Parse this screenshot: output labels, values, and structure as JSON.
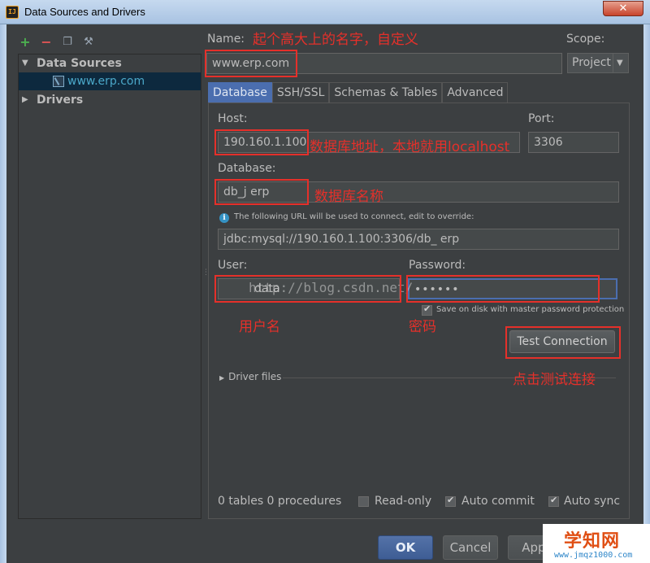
{
  "window": {
    "title": "Data Sources and Drivers",
    "close_glyph": "✕",
    "app_icon": "intellij-icon"
  },
  "toolbar": {
    "icons": [
      "add-icon",
      "remove-icon",
      "copy-icon",
      "wrench-icon"
    ]
  },
  "tree": {
    "data_sources_label": "Data Sources",
    "selected_item": "www.erp.com",
    "drivers_label": "Drivers"
  },
  "form": {
    "name_label": "Name:",
    "name_value": "www.erp.com",
    "scope_label": "Scope:",
    "scope_value": "Project",
    "tabs": [
      "Database",
      "SSH/SSL",
      "Schemas & Tables",
      "Advanced"
    ],
    "host_label": "Host:",
    "host_value": "190.160.1.100",
    "port_label": "Port:",
    "port_value": "3306",
    "database_label": "Database:",
    "database_value": "db_j     erp",
    "url_info": "The following URL will be used to connect, edit to override:",
    "url_value": "jdbc:mysql://190.160.1.100:3306/db_      erp",
    "user_label": "User:",
    "user_value": "data",
    "password_label": "Password:",
    "password_value": "••••••",
    "save_on_disk_label": "Save on disk with master password protection",
    "save_on_disk_checked": true,
    "test_connection_label": "Test Connection",
    "driver_files_label": "Driver files",
    "status_text": "0 tables 0 procedures",
    "readonly_label": "Read-only",
    "readonly_checked": false,
    "auto_commit_label": "Auto commit",
    "auto_commit_checked": true,
    "auto_sync_label": "Auto sync",
    "auto_sync_checked": true
  },
  "buttons": {
    "ok": "OK",
    "cancel": "Cancel",
    "apply": "Appl"
  },
  "annotations": {
    "name_note": "起个高大上的名字，自定义",
    "host_note": "数据库地址，本地就用localhost",
    "database_note": "数据库名称",
    "user_note": "用户名",
    "password_note": "密码",
    "test_note": "点击测试连接",
    "color": "#e5302a"
  },
  "watermark": "http://blog.csdn.net/",
  "corner_logo": {
    "title": "学知网",
    "url": "www.jmqz1000.com"
  }
}
